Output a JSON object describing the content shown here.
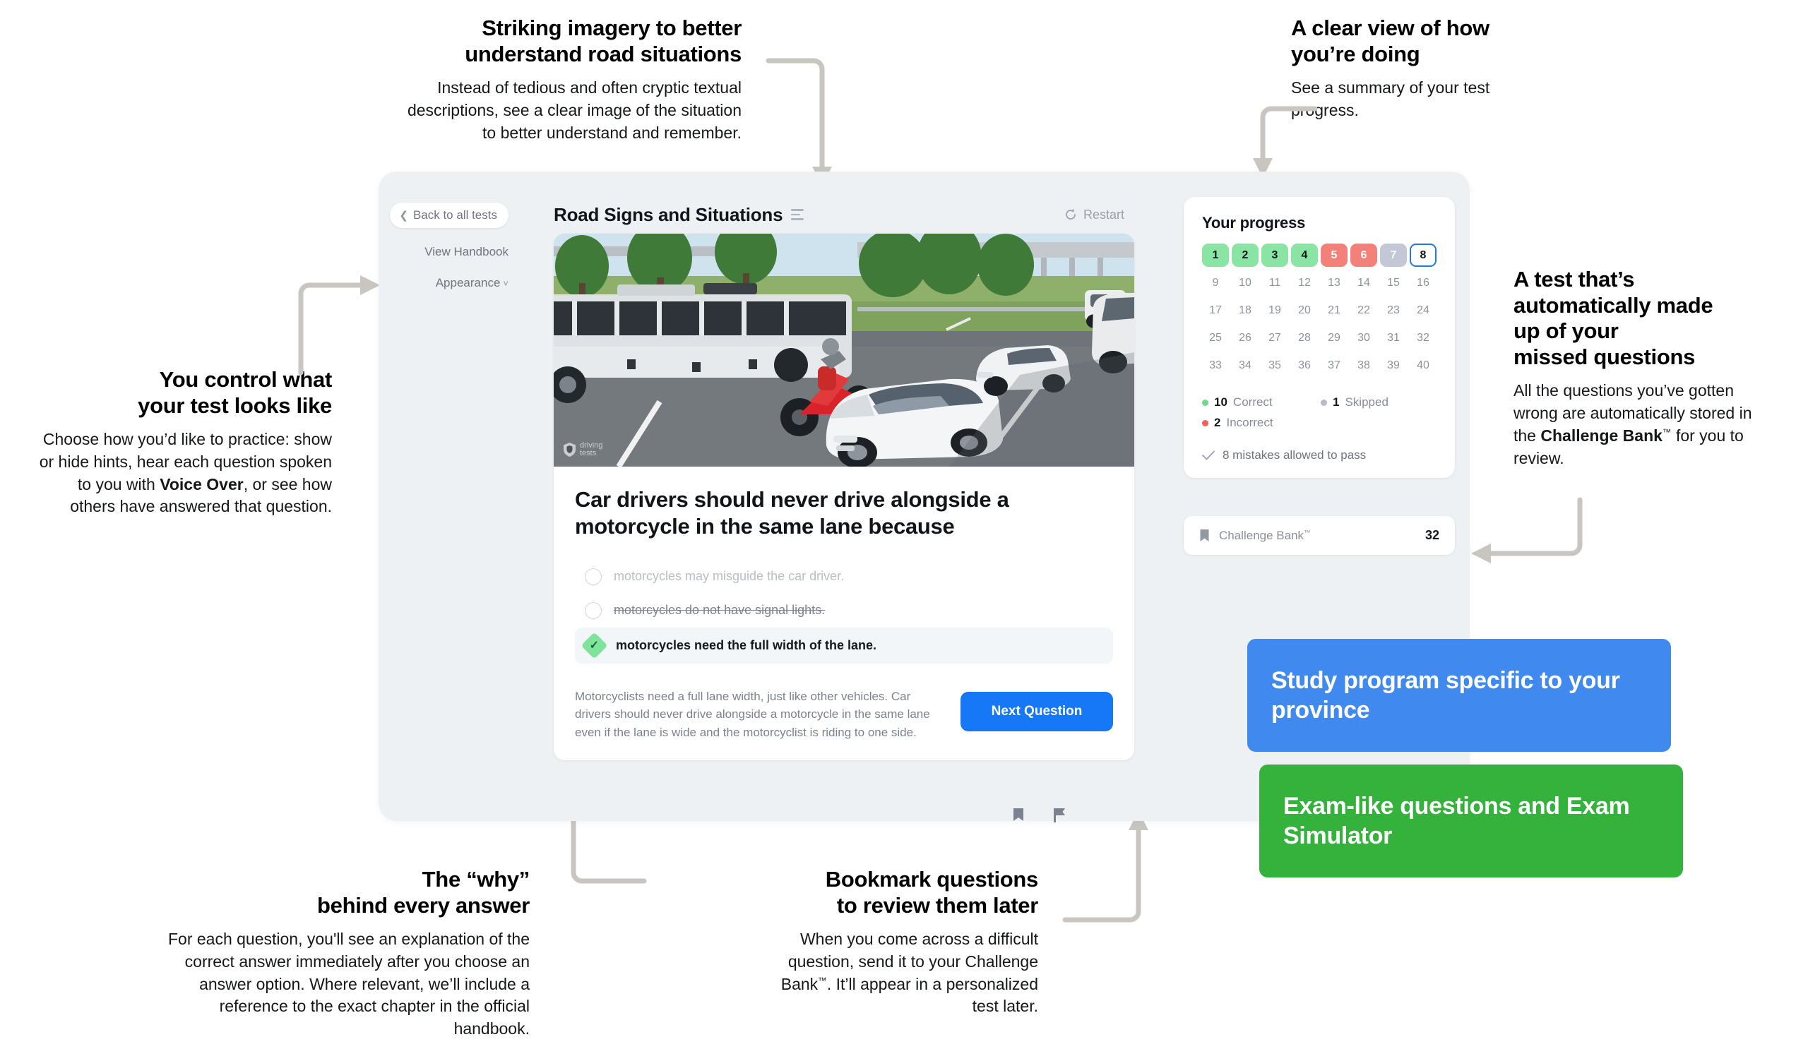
{
  "annotations": [
    {
      "id": "imagery",
      "title": "Striking imagery to better\nunderstand road situations",
      "body": "Instead of tedious and often cryptic textual descriptions, see a clear image of the situation to better understand and remember."
    },
    {
      "id": "clear-view",
      "title": "A clear view of how\nyou’re doing",
      "body": "See a summary of your test progress."
    },
    {
      "id": "control",
      "title": "You control what\nyour test looks like",
      "body_pre": "Choose how you’d like to practice: show or hide hints, hear each question spoken to you with ",
      "body_bold": "Voice Over",
      "body_post": ", or see how others have answered that question."
    },
    {
      "id": "missed",
      "title": "A test that’s\nautomatically made\nup of your\nmissed questions",
      "body_pre": "All the questions you’ve gotten wrong are automatically stored in the ",
      "body_bold": "Challenge Bank",
      "body_tm": "™",
      "body_post": " for you to review."
    },
    {
      "id": "why",
      "title": "The “why”\nbehind every answer",
      "body": "For each question, you'll see an explanation of the correct answer immediately after you choose an answer option. Where relevant, we’ll include a reference to the exact chapter in the official handbook."
    },
    {
      "id": "bookmark",
      "title": "Bookmark questions\nto review them later",
      "body_pre": "When you come across a difficult question, send it to your Challenge Bank",
      "body_tm": "™",
      "body_post": ". It’ll appear in a personalized test later."
    }
  ],
  "app": {
    "left_rail": {
      "back_label": "Back to all tests",
      "back_chevron": "chevron-left-icon",
      "links": [
        {
          "label": "View Handbook",
          "caret": ""
        },
        {
          "label": "Appearance",
          "caret": "⌄"
        }
      ]
    },
    "header": {
      "title": "Road Signs and Situations",
      "restart_label": "Restart",
      "restart_icon": "restart-icon"
    },
    "question": {
      "text": "Car drivers should never drive alongside a motorcycle in the same lane because",
      "image_alt": "Road scene: intercity bus, red motorcycle riding alongside a white SUV in the same lane, pickup trucks ahead",
      "watermark_line1": "driving",
      "watermark_line2": "tests",
      "answers": [
        {
          "text": "motorcycles may misguide the car driver.",
          "state": "dimmed"
        },
        {
          "text": "motorcycles do not have signal lights.",
          "state": "struck"
        },
        {
          "text": "motorcycles need the full width of the lane.",
          "state": "correct"
        }
      ],
      "explanation": "Motorcyclists need a full lane width, just like other vehicles. Car drivers should never drive alongside a motorcycle in the same lane even if the lane is wide and the motorcyclist is riding to one side.",
      "next_label": "Next Question"
    },
    "icon_bar": [
      {
        "icon": "bookmark-icon"
      },
      {
        "icon": "flag-icon"
      }
    ],
    "progress": {
      "title": "Your progress",
      "total_questions": 40,
      "cells": [
        {
          "n": "1",
          "state": "correct"
        },
        {
          "n": "2",
          "state": "correct"
        },
        {
          "n": "3",
          "state": "correct"
        },
        {
          "n": "4",
          "state": "correct"
        },
        {
          "n": "5",
          "state": "incorrect"
        },
        {
          "n": "6",
          "state": "incorrect"
        },
        {
          "n": "7",
          "state": "skipped"
        },
        {
          "n": "8",
          "state": "current"
        },
        {
          "n": "9",
          "state": ""
        },
        {
          "n": "10",
          "state": ""
        },
        {
          "n": "11",
          "state": ""
        },
        {
          "n": "12",
          "state": ""
        },
        {
          "n": "13",
          "state": ""
        },
        {
          "n": "14",
          "state": ""
        },
        {
          "n": "15",
          "state": ""
        },
        {
          "n": "16",
          "state": ""
        },
        {
          "n": "17",
          "state": ""
        },
        {
          "n": "18",
          "state": ""
        },
        {
          "n": "19",
          "state": ""
        },
        {
          "n": "20",
          "state": ""
        },
        {
          "n": "21",
          "state": ""
        },
        {
          "n": "22",
          "state": ""
        },
        {
          "n": "23",
          "state": ""
        },
        {
          "n": "24",
          "state": ""
        },
        {
          "n": "25",
          "state": ""
        },
        {
          "n": "26",
          "state": ""
        },
        {
          "n": "27",
          "state": ""
        },
        {
          "n": "28",
          "state": ""
        },
        {
          "n": "29",
          "state": ""
        },
        {
          "n": "30",
          "state": ""
        },
        {
          "n": "31",
          "state": ""
        },
        {
          "n": "32",
          "state": ""
        },
        {
          "n": "33",
          "state": ""
        },
        {
          "n": "34",
          "state": ""
        },
        {
          "n": "35",
          "state": ""
        },
        {
          "n": "36",
          "state": ""
        },
        {
          "n": "37",
          "state": ""
        },
        {
          "n": "38",
          "state": ""
        },
        {
          "n": "39",
          "state": ""
        },
        {
          "n": "40",
          "state": ""
        }
      ],
      "legend": {
        "correct_count": "10",
        "correct_label": "Correct",
        "skipped_count": "1",
        "skipped_label": "Skipped",
        "incorrect_count": "2",
        "incorrect_label": "Incorrect"
      },
      "pass_note": "8 mistakes allowed to pass",
      "pass_icon": "check-icon"
    },
    "challenge_bank": {
      "icon": "bookmark-icon",
      "label": "Challenge Bank",
      "tm": "™",
      "count": "32"
    }
  },
  "callouts": [
    {
      "id": "blue",
      "text": "Study program specific to your province",
      "color": "#4089ef"
    },
    {
      "id": "green",
      "text": "Exam-like questions and Exam Simulator",
      "color": "#34b23b"
    }
  ],
  "colors": {
    "correct": "#8ae5a4",
    "incorrect": "#f4807a",
    "skipped": "#c4c7d6",
    "current_border": "#1f7ae0",
    "primary": "#1677f7",
    "card_bg": "#eef1f3",
    "arrow": "#c9c6c2"
  }
}
